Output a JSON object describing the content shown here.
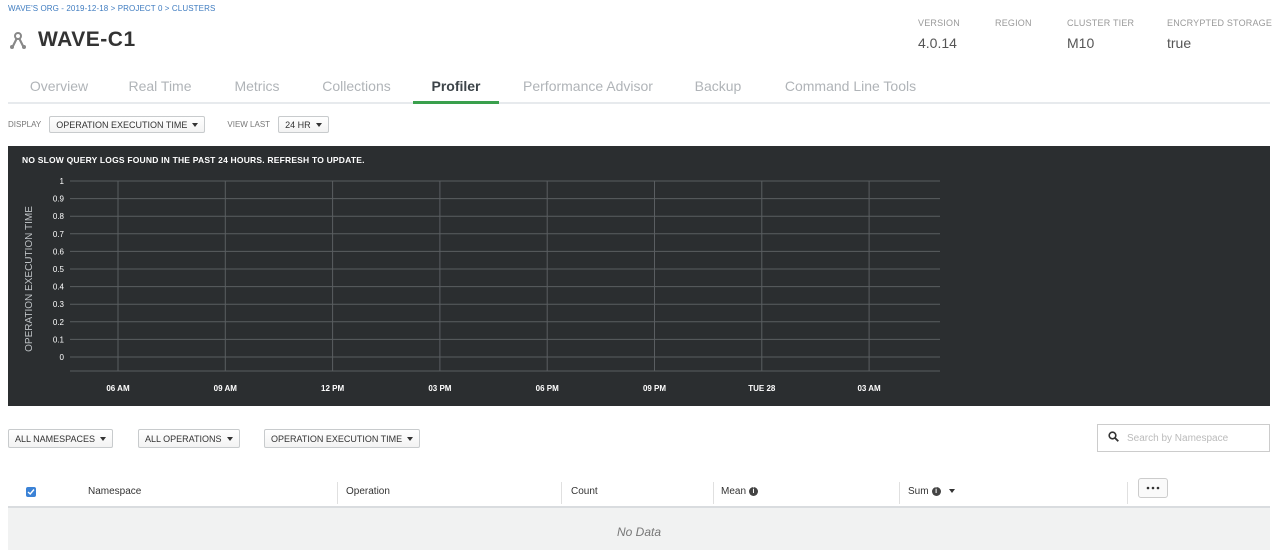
{
  "breadcrumb": "WAVE'S ORG - 2019-12-18 > PROJECT 0 > CLUSTERS",
  "title": "WAVE-C1",
  "meta": [
    {
      "label": "VERSION",
      "value": "4.0.14"
    },
    {
      "label": "REGION",
      "value": ""
    },
    {
      "label": "CLUSTER TIER",
      "value": "M10"
    },
    {
      "label": "ENCRYPTED STORAGE",
      "value": "true"
    }
  ],
  "tabs": [
    {
      "label": "Overview",
      "active": false
    },
    {
      "label": "Real Time",
      "active": false
    },
    {
      "label": "Metrics",
      "active": false
    },
    {
      "label": "Collections",
      "active": false
    },
    {
      "label": "Profiler",
      "active": true
    },
    {
      "label": "Performance Advisor",
      "active": false
    },
    {
      "label": "Backup",
      "active": false
    },
    {
      "label": "Command Line Tools",
      "active": false
    }
  ],
  "controls": {
    "display_label": "DISPLAY",
    "display_value": "OPERATION EXECUTION TIME",
    "view_last_label": "VIEW LAST",
    "view_last_value": "24 HR"
  },
  "chart_message": "NO SLOW QUERY LOGS FOUND IN THE PAST 24 HOURS. REFRESH TO UPDATE.",
  "chart_data": {
    "type": "scatter",
    "title": "",
    "xlabel": "",
    "ylabel": "OPERATION EXECUTION TIME",
    "yticks": [
      "0",
      "0.1",
      "0.2",
      "0.3",
      "0.4",
      "0.5",
      "0.6",
      "0.7",
      "0.8",
      "0.9",
      "1"
    ],
    "xticks": [
      "06 AM",
      "09 AM",
      "12 PM",
      "03 PM",
      "06 PM",
      "09 PM",
      "TUE 28",
      "03 AM"
    ],
    "ylim": [
      0,
      1
    ],
    "grid": true,
    "series": [],
    "colors": {
      "background": "#2b2e30",
      "grid": "#5a5e61",
      "text": "#ffffff"
    }
  },
  "filters": {
    "namespaces": "ALL NAMESPACES",
    "operations": "ALL OPERATIONS",
    "metric": "OPERATION EXECUTION TIME",
    "search_placeholder": "Search by Namespace"
  },
  "table": {
    "columns": [
      "Namespace",
      "Operation",
      "Count",
      "Mean",
      "Sum"
    ],
    "empty_text": "No Data"
  },
  "colors": {
    "accent": "#3aa04d",
    "link": "#3f7cc0",
    "checkbox": "#3b82d6"
  }
}
